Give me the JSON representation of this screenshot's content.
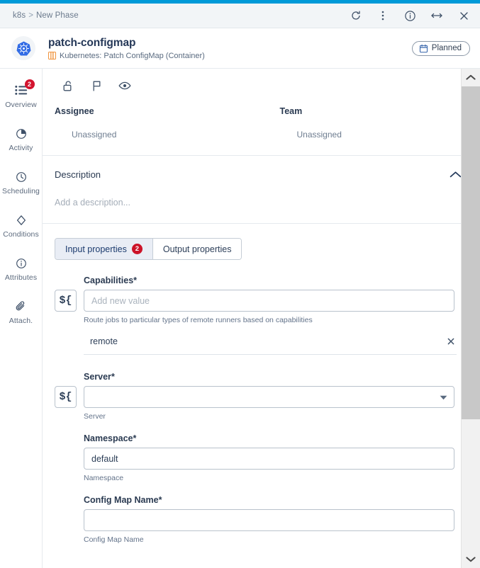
{
  "window": {
    "breadcrumb_root": "k8s",
    "breadcrumb_sep": ">",
    "breadcrumb_current": "New Phase",
    "actions": [
      {
        "name": "refresh-icon",
        "label": "Refresh"
      },
      {
        "name": "more-options-icon",
        "label": "More options"
      },
      {
        "name": "info-icon",
        "label": "Info"
      },
      {
        "name": "expand-width-icon",
        "label": "Expand"
      },
      {
        "name": "close-icon",
        "label": "Close"
      }
    ],
    "accent_color": "#009ad8"
  },
  "header": {
    "avatar_icon": "kubernetes-logo",
    "title": "patch-configmap",
    "subtitle": "Kubernetes: Patch ConfigMap (Container)",
    "subtitle_icon": "container-icon",
    "status": {
      "label": "Planned",
      "icon": "calendar-icon"
    }
  },
  "sidebar": {
    "items": [
      {
        "label": "Overview",
        "icon": "list-icon",
        "badge": "2",
        "active": true
      },
      {
        "label": "Activity",
        "icon": "pie-clock-icon",
        "badge": "",
        "active": false
      },
      {
        "label": "Scheduling",
        "icon": "clock-icon",
        "badge": "",
        "active": false
      },
      {
        "label": "Conditions",
        "icon": "diamond-icon",
        "badge": "",
        "active": false
      },
      {
        "label": "Attributes",
        "icon": "info-circle-icon",
        "badge": "",
        "active": false
      },
      {
        "label": "Attach.",
        "icon": "paperclip-icon",
        "badge": "",
        "active": false
      }
    ]
  },
  "toolbar": {
    "icons": [
      {
        "name": "lock-open-icon",
        "label": "Lock"
      },
      {
        "name": "flag-icon",
        "label": "Flag"
      },
      {
        "name": "eye-icon",
        "label": "Watch"
      }
    ]
  },
  "meta": {
    "assignee_label": "Assignee",
    "assignee_value": "Unassigned",
    "team_label": "Team",
    "team_value": "Unassigned"
  },
  "description": {
    "title": "Description",
    "collapse_icon": "chevron-up-icon",
    "placeholder": "Add a description..."
  },
  "tabs": [
    {
      "label": "Input properties",
      "badge": "2",
      "active": true
    },
    {
      "label": "Output properties",
      "badge": "",
      "active": false
    }
  ],
  "form": {
    "expression_button_label": "${",
    "fields": [
      {
        "label": "Capabilities",
        "required": "*",
        "value": "",
        "placeholder": "Add new value",
        "hint": "Route jobs to particular types of remote runners based on capabilities",
        "has_expr": true,
        "has_add": true,
        "add_icon": "plus-icon",
        "chips": [
          {
            "text": "remote",
            "remove_icon": "close-icon"
          }
        ]
      },
      {
        "label": "Server",
        "required": "*",
        "value": "",
        "placeholder": "",
        "hint": "Server",
        "has_expr": true,
        "is_select": true,
        "caret_icon": "chevron-down-icon"
      },
      {
        "label": "Namespace",
        "required": "*",
        "value": "default",
        "placeholder": "",
        "hint": "Namespace",
        "has_expr": false
      },
      {
        "label": "Config Map Name",
        "required": "*",
        "value": "",
        "placeholder": "",
        "hint": "Config Map Name",
        "has_expr": false
      }
    ]
  },
  "scrollbar": {
    "up_icon": "chevron-up-icon",
    "down_icon": "chevron-down-icon"
  }
}
